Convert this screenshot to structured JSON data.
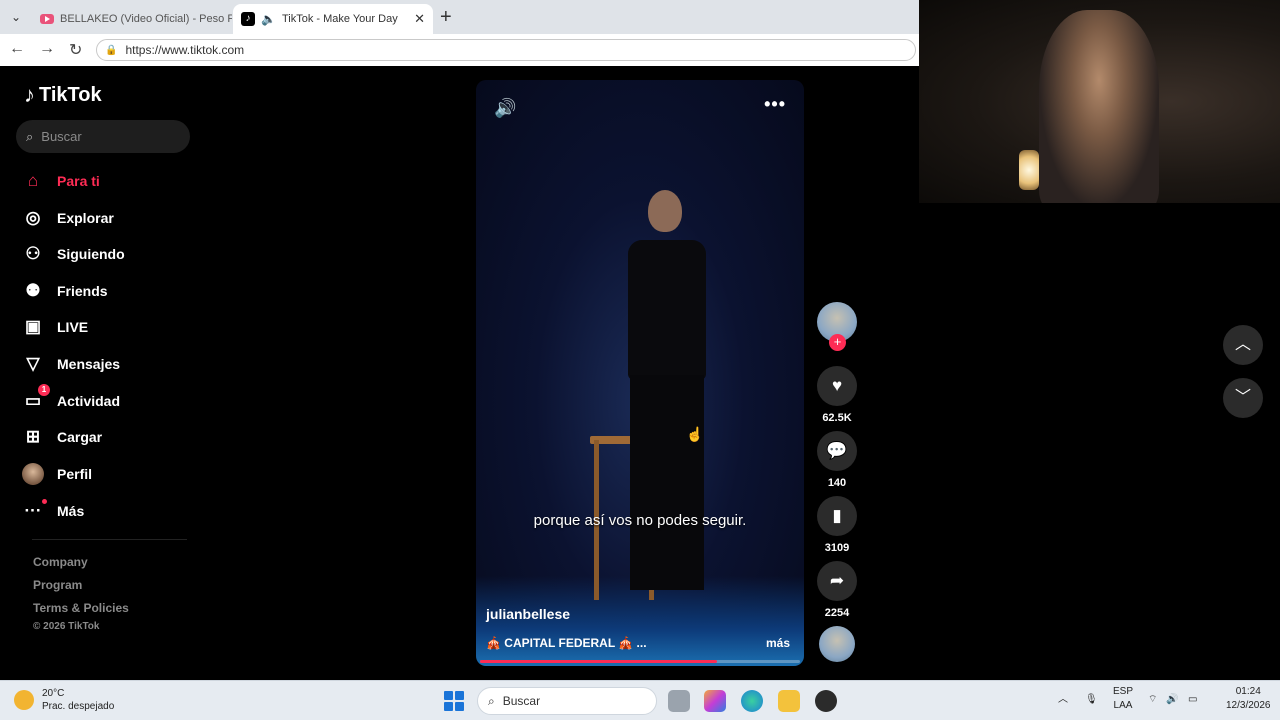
{
  "browser": {
    "tabs": [
      {
        "title": "BELLAKEO (Video Oficial) - Peso Pl",
        "active": false
      },
      {
        "title": "TikTok - Make Your Day",
        "active": true
      }
    ],
    "url": "https://www.tiktok.com"
  },
  "sidebar": {
    "logo": "TikTok",
    "search_placeholder": "Buscar",
    "items": [
      {
        "label": "Para ti",
        "icon": "home-icon",
        "active": true
      },
      {
        "label": "Explorar",
        "icon": "compass-icon"
      },
      {
        "label": "Siguiendo",
        "icon": "following-icon"
      },
      {
        "label": "Friends",
        "icon": "friends-icon"
      },
      {
        "label": "LIVE",
        "icon": "live-tv-icon"
      },
      {
        "label": "Mensajes",
        "icon": "send-icon"
      },
      {
        "label": "Actividad",
        "icon": "activity-icon",
        "badge": "1"
      },
      {
        "label": "Cargar",
        "icon": "upload-icon"
      },
      {
        "label": "Perfil",
        "icon": "profile-avatar"
      },
      {
        "label": "Más",
        "icon": "more-icon"
      }
    ],
    "footer": {
      "links": [
        "Company",
        "Program",
        "Terms & Policies"
      ],
      "copyright": "© 2026 TikTok"
    }
  },
  "video": {
    "caption": "porque así vos no podes seguir.",
    "author": "julianbellese",
    "description": "🎪 CAPITAL FEDERAL 🎪 ...",
    "more": "más",
    "progress": 0.74
  },
  "actions": {
    "likes": "62.5K",
    "comments": "140",
    "saves": "3109",
    "shares": "2254"
  },
  "taskbar": {
    "weather_temp": "20°C",
    "weather_desc": "Prac. despejado",
    "search_placeholder": "Buscar",
    "lang_top": "ESP",
    "lang_bottom": "LAA",
    "time": "01:24",
    "date": "12/3/2026"
  },
  "colors": {
    "accent": "#fe2c55",
    "background": "#000000"
  }
}
